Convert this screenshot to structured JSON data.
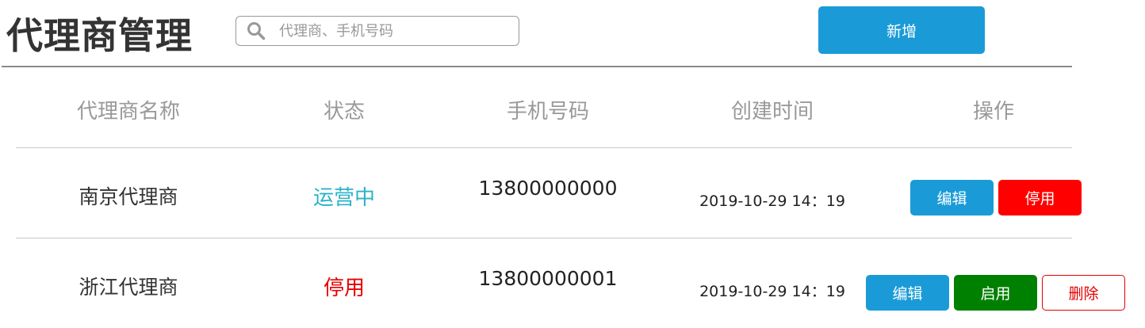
{
  "header": {
    "title": "代理商管理",
    "search": {
      "placeholder": "代理商、手机号码",
      "value": ""
    },
    "add_label": "新增"
  },
  "table": {
    "columns": [
      "代理商名称",
      "状态",
      "手机号码",
      "创建时间",
      "操作"
    ],
    "rows": [
      {
        "name": "南京代理商",
        "status": "运营中",
        "phone": "13800000000",
        "created": "2019-10-29 14：19",
        "actions": [
          "编辑",
          "停用"
        ]
      },
      {
        "name": "浙江代理商",
        "status": "停用",
        "phone": "13800000001",
        "created": "2019-10-29 14：19",
        "actions": [
          "编辑",
          "启用",
          "删除"
        ]
      }
    ]
  },
  "colors": {
    "primary": "#1a9bd7",
    "danger": "#ff0000",
    "success": "#008000",
    "status_running": "#2ab3c9",
    "status_stopped": "#e60000"
  },
  "icons": {
    "search": "search-icon"
  }
}
